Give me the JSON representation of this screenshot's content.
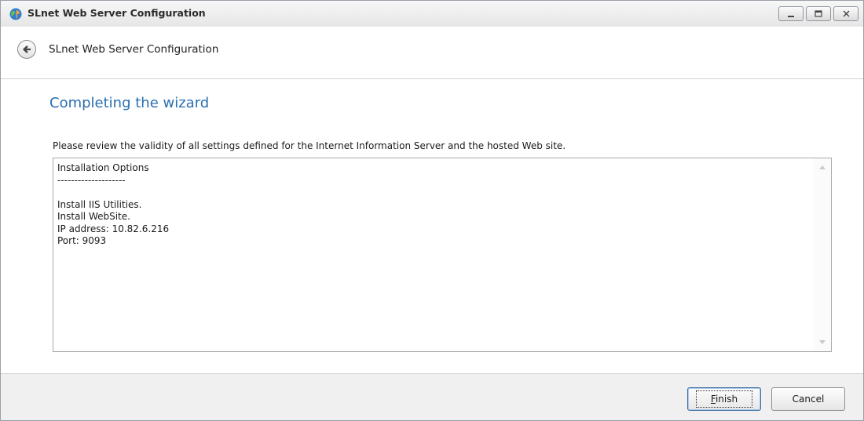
{
  "window": {
    "title": "SLnet Web Server Configuration",
    "icon": "app-globe-icon",
    "controls": [
      "minimize",
      "maximize",
      "close"
    ]
  },
  "header": {
    "back_icon": "back-arrow-icon",
    "title": "SLnet Web Server Configuration"
  },
  "page": {
    "heading": "Completing the wizard",
    "description": "Please review the validity of all settings defined for the Internet Information Server and the hosted Web site.",
    "summary_text": "Installation Options\n--------------------\n\nInstall IIS Utilities.\nInstall WebSite.\nIP address: 10.82.6.216\nPort: 9093"
  },
  "footer": {
    "finish_label": "Finish",
    "cancel_label": "Cancel"
  },
  "colors": {
    "heading": "#2a6fb0",
    "footer_bg": "#f0f0f0",
    "titlebar_bg": "#e6e6e6"
  }
}
